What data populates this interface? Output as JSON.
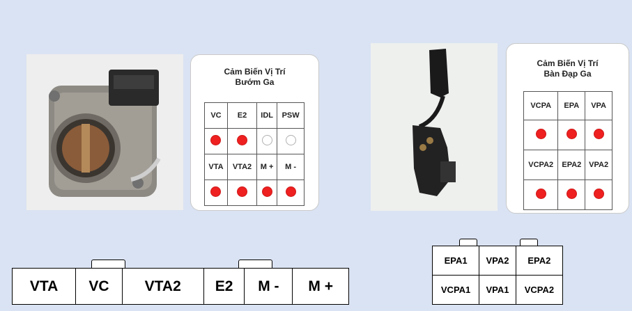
{
  "colors": {
    "background": "#dae3f3",
    "pin_used": "#ee2020",
    "pin_unused": "#ffffff"
  },
  "throttle_card": {
    "title_line1": "Cảm Biến Vị Trí",
    "title_line2": "Bướm Ga",
    "rows": [
      {
        "type": "labels",
        "cells": [
          "VC",
          "E2",
          "IDL",
          "PSW"
        ]
      },
      {
        "type": "dots",
        "cells": [
          "used",
          "used",
          "unused",
          "unused"
        ]
      },
      {
        "type": "labels",
        "cells": [
          "VTA",
          "VTA2",
          "M +",
          "M -"
        ]
      },
      {
        "type": "dots",
        "cells": [
          "used",
          "used",
          "used",
          "used"
        ]
      }
    ]
  },
  "pedal_card": {
    "title_line1": "Cảm Biến Vị Trí",
    "title_line2": "Bàn Đạp Ga",
    "rows": [
      {
        "type": "labels",
        "cells": [
          "VCPA",
          "EPA",
          "VPA"
        ]
      },
      {
        "type": "dots",
        "cells": [
          "used",
          "used",
          "used"
        ]
      },
      {
        "type": "labels",
        "cells": [
          "VCPA2",
          "EPA2",
          "VPA2"
        ]
      },
      {
        "type": "dots",
        "cells": [
          "used",
          "used",
          "used"
        ]
      }
    ]
  },
  "throttle_connector": {
    "pins": [
      "VTA",
      "VC",
      "VTA2",
      "E2",
      "M -",
      "M +"
    ]
  },
  "pedal_connector": {
    "rows": [
      [
        "EPA1",
        "VPA2",
        "EPA2"
      ],
      [
        "VCPA1",
        "VPA1",
        "VCPA2"
      ]
    ]
  },
  "photos": {
    "throttle": "throttle-body-photo",
    "pedal": "accelerator-pedal-photo"
  }
}
